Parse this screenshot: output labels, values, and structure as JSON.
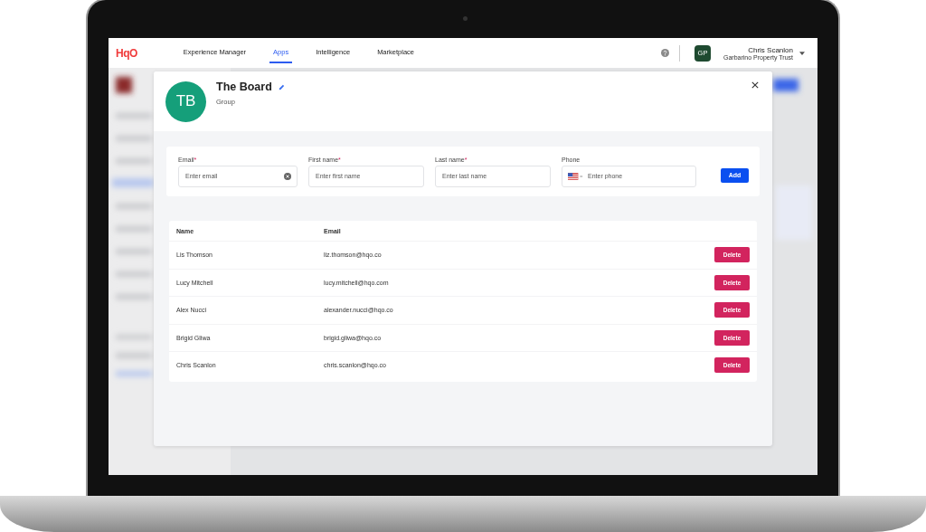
{
  "nav": {
    "logo": "HqO",
    "tabs": [
      {
        "label": "Experience Manager",
        "selected": false
      },
      {
        "label": "Apps",
        "selected": true
      },
      {
        "label": "Intelligence",
        "selected": false
      },
      {
        "label": "Marketplace",
        "selected": false
      }
    ],
    "user": {
      "avatar": "GP",
      "name": "Chris Scanlon",
      "org": "Garbarino Property Trust"
    }
  },
  "modal": {
    "avatar": "TB",
    "title": "The Board",
    "subtitle": "Group",
    "fields": [
      {
        "kind": "clearable",
        "label": "Email",
        "required_mark": "*",
        "placeholder": "Enter email"
      },
      {
        "kind": "text",
        "label": "First name",
        "required_mark": "*",
        "placeholder": "Enter first name"
      },
      {
        "kind": "text",
        "label": "Last name",
        "required_mark": "*",
        "placeholder": "Enter last name"
      },
      {
        "kind": "phone",
        "label": "Phone",
        "placeholder": "Enter phone"
      }
    ],
    "add_button": "Add",
    "table": {
      "columns": [
        "Name",
        "Email"
      ],
      "rows": [
        {
          "name": "Lis Thomson",
          "email": "liz.thomson@hqo.co",
          "action": "Delete"
        },
        {
          "name": "Lucy Mitchell",
          "email": "lucy.mitchell@hqo.com",
          "action": "Delete"
        },
        {
          "name": "Alex Nucci",
          "email": "alexander.nucci@hqo.co",
          "action": "Delete"
        },
        {
          "name": "Brigid Gliwa",
          "email": "brigid.gliwa@hqo.co",
          "action": "Delete"
        },
        {
          "name": "Chris Scanlon",
          "email": "chris.scanlon@hqo.co",
          "action": "Delete"
        }
      ]
    }
  }
}
